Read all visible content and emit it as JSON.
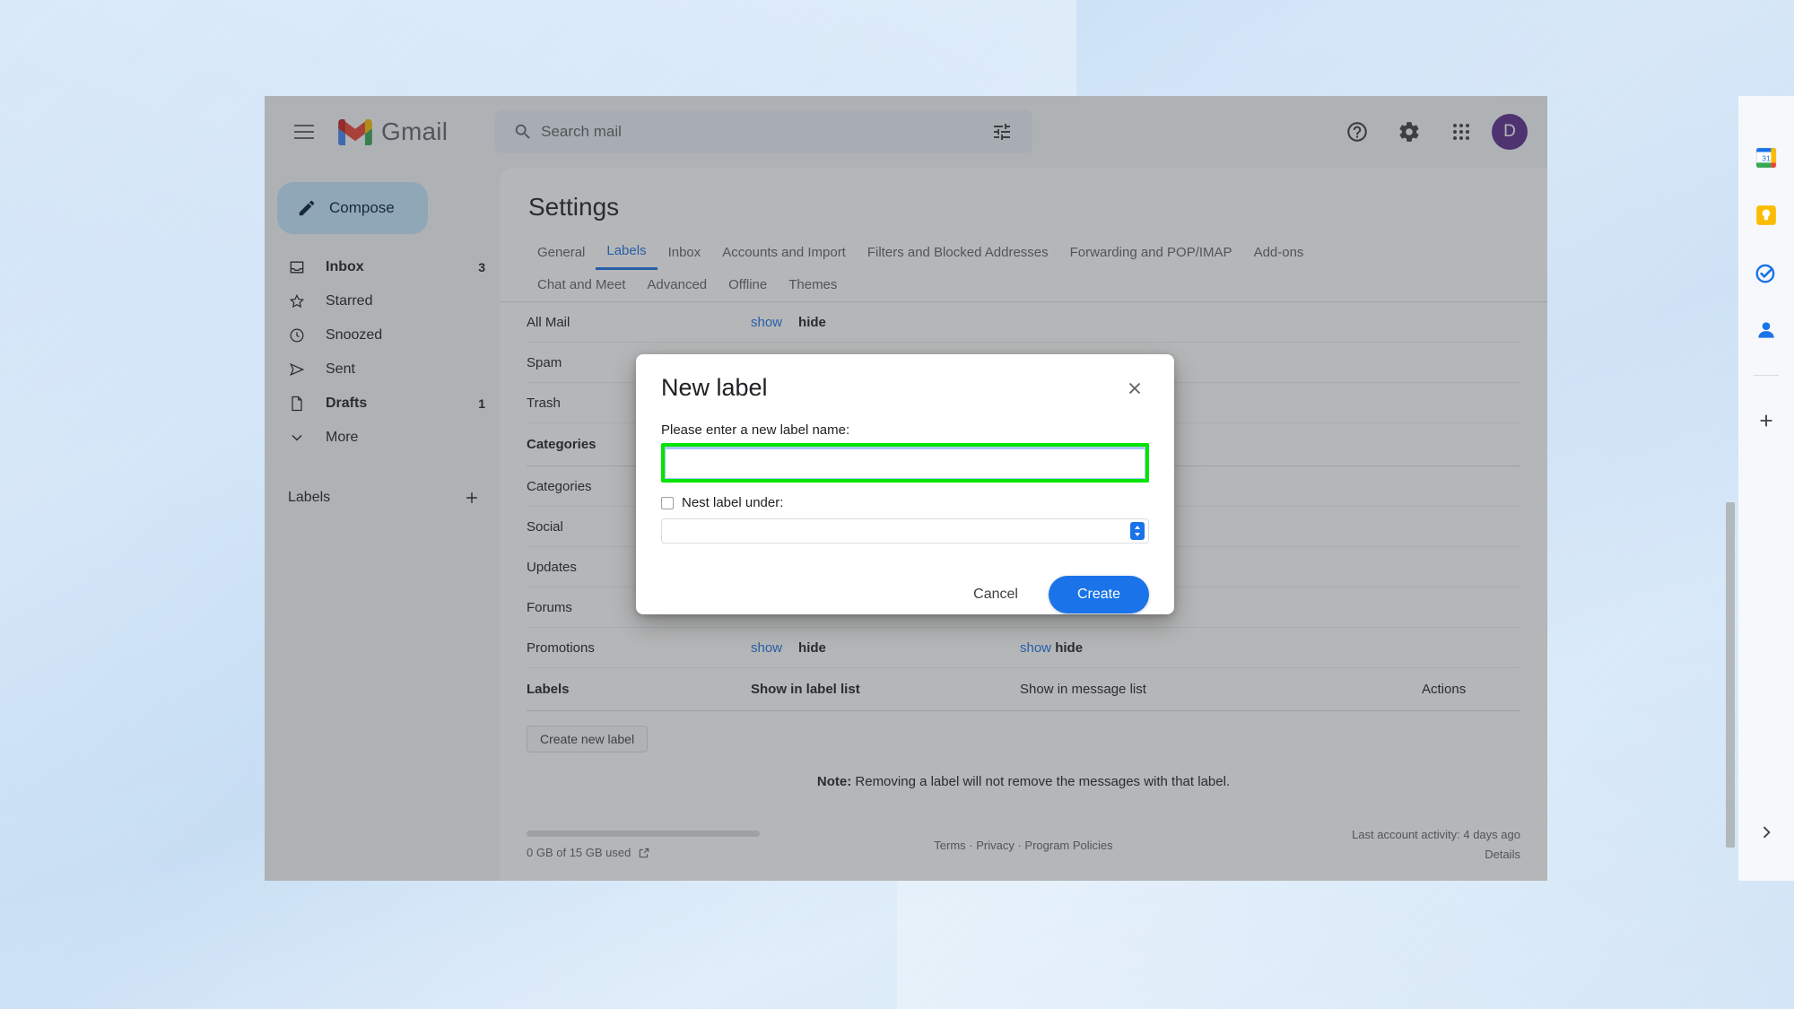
{
  "app": {
    "brand": "Gmail",
    "avatar_initial": "D",
    "accent_blue": "#1a73e8",
    "highlight_green": "#00e400",
    "avatar_color": "#5b2d8e"
  },
  "search": {
    "placeholder": "Search mail",
    "value": ""
  },
  "sidebar": {
    "compose_label": "Compose",
    "items": [
      {
        "label": "Inbox",
        "count": "3",
        "icon": "inbox-icon",
        "bold": true
      },
      {
        "label": "Starred",
        "count": "",
        "icon": "star-icon",
        "bold": false
      },
      {
        "label": "Snoozed",
        "count": "",
        "icon": "clock-icon",
        "bold": false
      },
      {
        "label": "Sent",
        "count": "",
        "icon": "send-icon",
        "bold": false
      },
      {
        "label": "Drafts",
        "count": "1",
        "icon": "drafts-icon",
        "bold": true
      },
      {
        "label": "More",
        "count": "",
        "icon": "chevron-down-icon",
        "bold": false
      }
    ],
    "labels_header": "Labels"
  },
  "settings": {
    "title": "Settings",
    "tabs_row1": [
      {
        "label": "General",
        "active": false
      },
      {
        "label": "Labels",
        "active": true
      },
      {
        "label": "Inbox",
        "active": false
      },
      {
        "label": "Accounts and Import",
        "active": false
      },
      {
        "label": "Filters and Blocked Addresses",
        "active": false
      },
      {
        "label": "Forwarding and POP/IMAP",
        "active": false
      },
      {
        "label": "Add-ons",
        "active": false
      }
    ],
    "tabs_row2": [
      {
        "label": "Chat and Meet",
        "active": false
      },
      {
        "label": "Advanced",
        "active": false
      },
      {
        "label": "Offline",
        "active": false
      },
      {
        "label": "Themes",
        "active": false
      }
    ],
    "system_rows": [
      {
        "name": "All Mail",
        "bold": false,
        "label_list": [
          "show",
          "hide"
        ],
        "label_list_selected": "hide",
        "message_list": []
      },
      {
        "name": "Spam",
        "bold": false,
        "label_list": [
          "show",
          "hide"
        ],
        "label_list_selected": "hide",
        "message_list": []
      },
      {
        "name": "Trash",
        "bold": false,
        "label_list": [
          "show",
          "hide"
        ],
        "label_list_selected": "hide",
        "message_list": []
      }
    ],
    "categories_header": "Categories",
    "category_rows": [
      {
        "name": "Categories",
        "bold": false,
        "message_list_selected": "hide"
      },
      {
        "name": "Social",
        "bold": false,
        "message_list_selected": "hide"
      },
      {
        "name": "Updates",
        "bold": false,
        "message_list_selected": "hide"
      },
      {
        "name": "Forums",
        "bold": false,
        "message_list_selected": "hide"
      },
      {
        "name": "Promotions",
        "bold": false,
        "message_list_selected": "hide"
      }
    ],
    "col_show_label_list": "Show in label list",
    "col_show_message_list": "Show in message list",
    "labels_table": {
      "col_labels": "Labels",
      "col_show_label_list": "Show in label list",
      "col_show_message_list": "Show in message list",
      "col_actions": "Actions",
      "create_button": "Create new label"
    },
    "note_prefix": "Note:",
    "note_text": "Removing a label will not remove the messages with that label.",
    "show_text": "show",
    "hide_text": "hide"
  },
  "footer": {
    "storage": "0 GB of 15 GB used",
    "links": [
      "Terms",
      "Privacy",
      "Program Policies"
    ],
    "links_joined": "Terms · Privacy · Program Policies",
    "last_activity": "Last account activity: 4 days ago",
    "details": "Details"
  },
  "rail": {
    "icons": [
      "calendar-icon",
      "keep-icon",
      "tasks-icon",
      "contacts-icon",
      "add-icon"
    ],
    "calendar_day": "31"
  },
  "dialog": {
    "title": "New label",
    "prompt": "Please enter a new label name:",
    "name_value": "",
    "name_placeholder": "",
    "nest_label": "Nest label under:",
    "nest_checked": false,
    "nest_value": "",
    "cancel_label": "Cancel",
    "create_label": "Create"
  }
}
